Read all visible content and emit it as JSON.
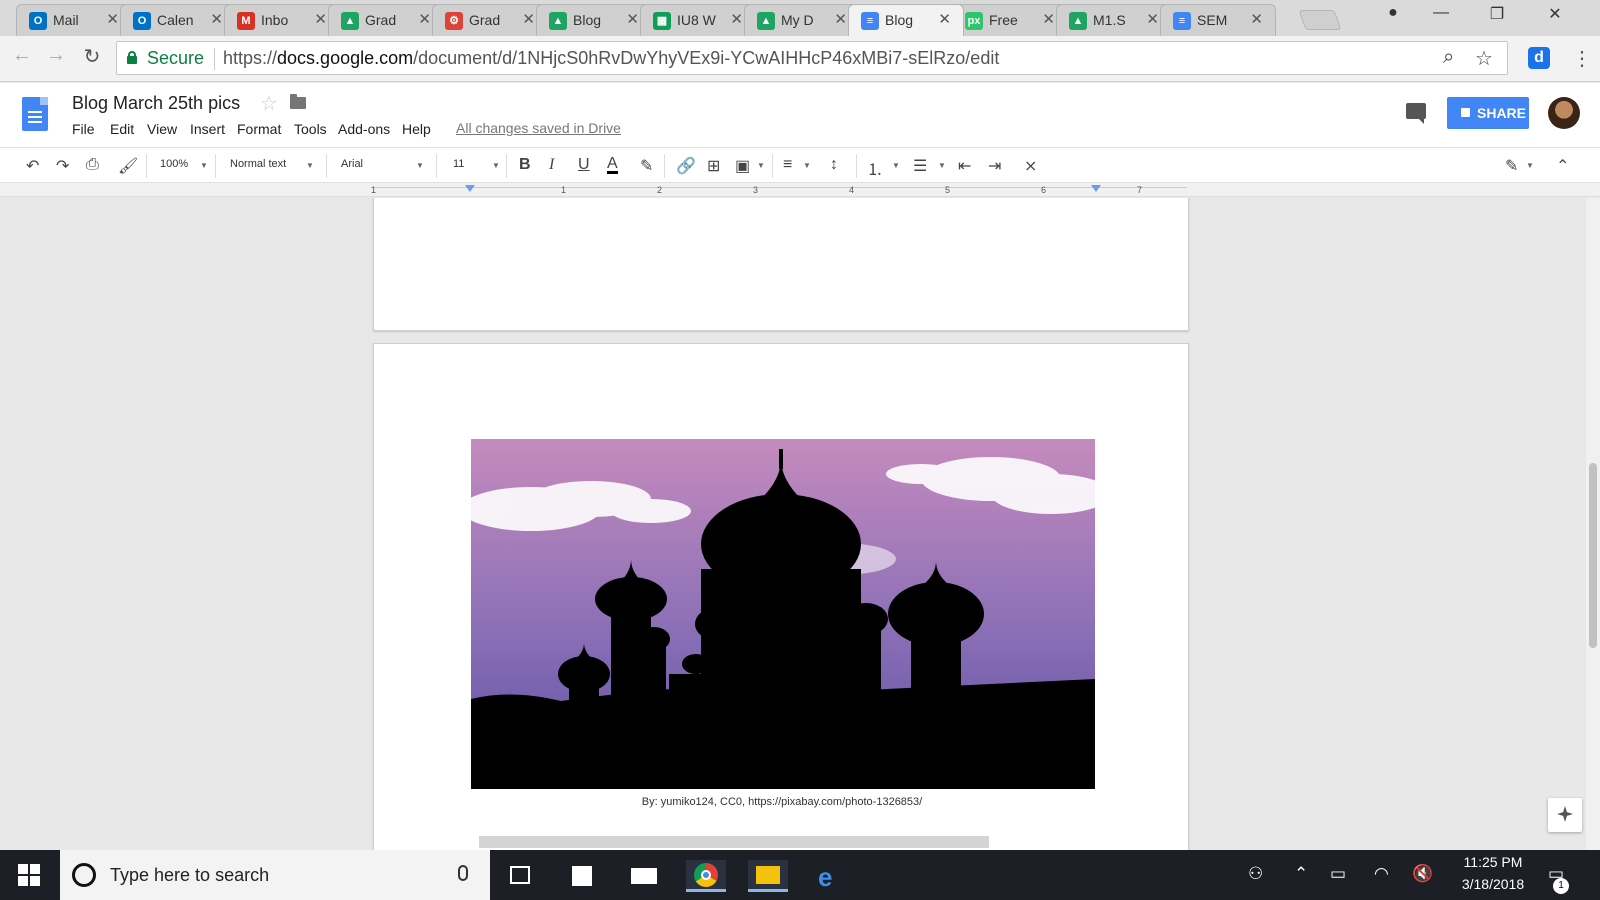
{
  "browser": {
    "tabs": [
      {
        "label": "Mail",
        "icon": "outlook-icon",
        "color": "#0072c6",
        "glyph": "O"
      },
      {
        "label": "Calen",
        "icon": "outlook-icon",
        "color": "#0072c6",
        "glyph": "O"
      },
      {
        "label": "Inbo",
        "icon": "gmail-icon",
        "color": "#d93025",
        "glyph": "M"
      },
      {
        "label": "Grad",
        "icon": "drive-icon",
        "color": "#1fa463",
        "glyph": "▲"
      },
      {
        "label": "Grad",
        "icon": "app-icon",
        "color": "#db4437",
        "glyph": "⚙"
      },
      {
        "label": "Blog",
        "icon": "drive-icon",
        "color": "#1fa463",
        "glyph": "▲"
      },
      {
        "label": "IU8 W",
        "icon": "sheets-icon",
        "color": "#0f9d58",
        "glyph": "▦"
      },
      {
        "label": "My D",
        "icon": "drive-icon",
        "color": "#1fa463",
        "glyph": "▲"
      },
      {
        "label": "Blog",
        "icon": "docs-icon",
        "color": "#4285f4",
        "glyph": "≡",
        "active": true
      },
      {
        "label": "Free",
        "icon": "pixabay-icon",
        "color": "#2ec66d",
        "glyph": "px"
      },
      {
        "label": "M1.S",
        "icon": "drive-icon",
        "color": "#1fa463",
        "glyph": "▲"
      },
      {
        "label": "SEM",
        "icon": "docs-icon",
        "color": "#4285f4",
        "glyph": "≡"
      }
    ],
    "secure_label": "Secure",
    "url_scheme": "https://",
    "url_host": "docs.google.com",
    "url_path": "/document/d/1NHjcS0hRvDwYhyVEx9i-YCwAIHHcP46xMBi7-sElRzo/edit"
  },
  "docs": {
    "title": "Blog March 25th pics",
    "menu": [
      "File",
      "Edit",
      "View",
      "Insert",
      "Format",
      "Tools",
      "Add-ons",
      "Help"
    ],
    "saved_status": "All changes saved in Drive",
    "share_label": "SHARE",
    "toolbar": {
      "zoom": "100%",
      "style": "Normal text",
      "font": "Arial",
      "size": "11"
    },
    "ruler_numbers": [
      "1",
      "1",
      "2",
      "3",
      "4",
      "5",
      "6",
      "7"
    ],
    "caption": "By: yumiko124, CC0, https://pixabay.com/photo-1326853/"
  },
  "taskbar": {
    "search_placeholder": "Type here to search",
    "time": "11:25 PM",
    "date": "3/18/2018",
    "notification_count": "1"
  },
  "colors": {
    "docs_blue": "#4285f4",
    "secure_green": "#0b8043",
    "sky_top": "#c58bbe",
    "sky_bottom": "#5e4fa3"
  }
}
